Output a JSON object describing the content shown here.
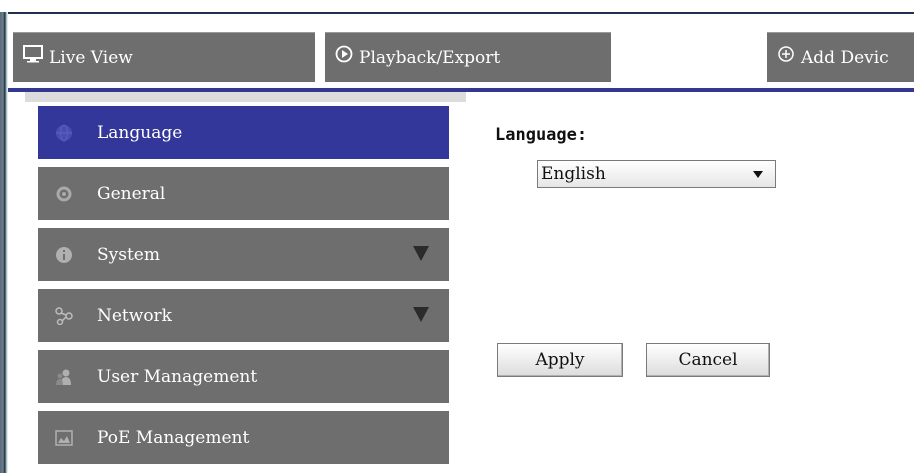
{
  "topbar": {
    "tabs": [
      {
        "label": "Live View",
        "icon": "monitor-icon"
      },
      {
        "label": "Playback/Export",
        "icon": "play-circle-icon"
      },
      {
        "label": "Add Devic",
        "icon": "plus-circle-icon"
      }
    ]
  },
  "sidebar": {
    "items": [
      {
        "label": "Language",
        "icon": "globe-icon",
        "active": true
      },
      {
        "label": "General",
        "icon": "gear-icon"
      },
      {
        "label": "System",
        "icon": "info-icon",
        "expandable": true
      },
      {
        "label": "Network",
        "icon": "network-icon",
        "expandable": true
      },
      {
        "label": "User Management",
        "icon": "users-icon"
      },
      {
        "label": "PoE Management",
        "icon": "poe-icon"
      }
    ]
  },
  "main": {
    "language_label": "Language:",
    "language_select": {
      "value": "English"
    },
    "apply_label": "Apply",
    "cancel_label": "Cancel"
  },
  "colors": {
    "accent": "#34379a",
    "nav_bg": "#6e6e6e",
    "top_border": "#1e2f4f"
  }
}
